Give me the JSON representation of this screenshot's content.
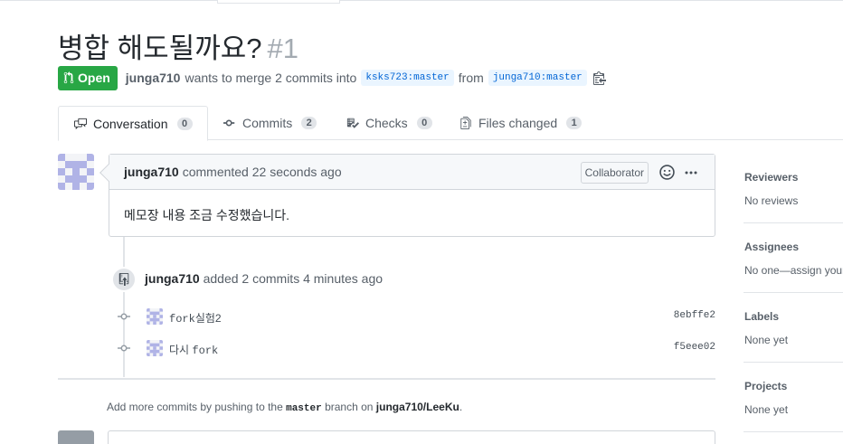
{
  "pr": {
    "title": "병합 해도될까요?",
    "number": "#1",
    "state": "Open",
    "author": "junga710",
    "merge_text": "wants to merge 2 commits into",
    "base_branch": "ksks723:master",
    "from_text": "from",
    "head_branch": "junga710:master"
  },
  "tabs": [
    {
      "label": "Conversation",
      "count": "0",
      "icon": "comment-discussion-icon"
    },
    {
      "label": "Commits",
      "count": "2",
      "icon": "git-commit-icon"
    },
    {
      "label": "Checks",
      "count": "0",
      "icon": "checklist-icon"
    },
    {
      "label": "Files changed",
      "count": "1",
      "icon": "file-diff-icon"
    }
  ],
  "comment": {
    "author": "junga710",
    "action": "commented",
    "time": "22 seconds ago",
    "role_badge": "Collaborator",
    "body": "메모장 내용 조금 수정했습니다."
  },
  "event": {
    "author": "junga710",
    "action": "added 2 commits",
    "time": "4 minutes ago"
  },
  "commits": [
    {
      "message_prefix": "fork",
      "message_suffix": "실험2",
      "sha": "8ebffe2"
    },
    {
      "message_prefix": "다시 ",
      "message_suffix": "fork",
      "sha": "f5eee02"
    }
  ],
  "push_note": {
    "prefix": "Add more commits by pushing to the",
    "branch": "master",
    "middle": "branch on",
    "repo": "junga710/LeeKu",
    "suffix": "."
  },
  "sidebar": [
    {
      "heading": "Reviewers",
      "value": "No reviews"
    },
    {
      "heading": "Assignees",
      "value": "No one—assign yourself"
    },
    {
      "heading": "Labels",
      "value": "None yet"
    },
    {
      "heading": "Projects",
      "value": "None yet"
    }
  ],
  "colors": {
    "open_green": "#28a745",
    "link_blue": "#0366d6",
    "branch_bg": "#eaf5ff",
    "border": "#d1d5da",
    "muted": "#586069"
  }
}
